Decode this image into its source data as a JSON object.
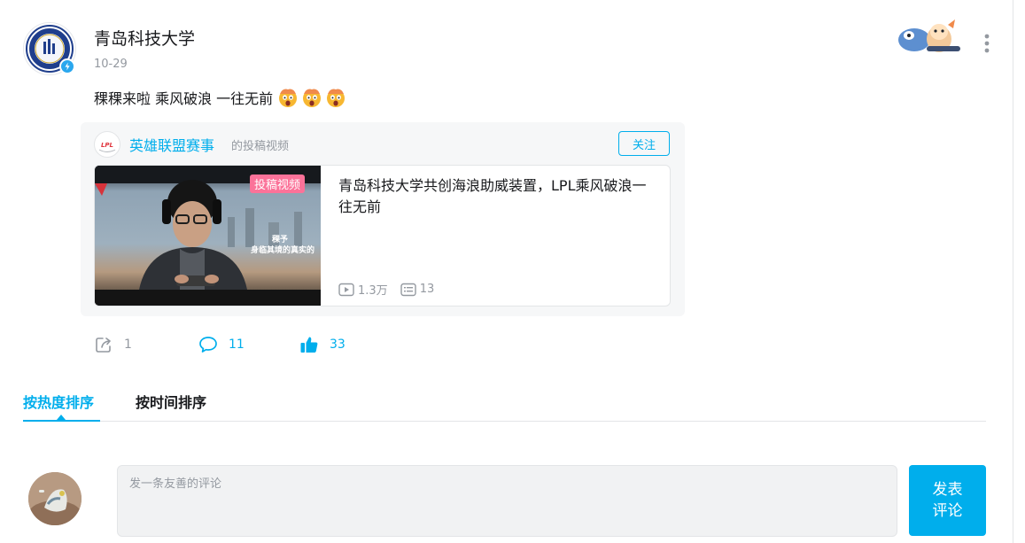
{
  "post": {
    "author": {
      "name": "青岛科技大学",
      "avatar_logo_text": "QUST",
      "verified": true
    },
    "date": "10-29",
    "text": "稞稞来啦 乘风破浪 一往无前",
    "emojis": [
      "shocked-face-emoji",
      "shocked-face-emoji",
      "shocked-face-emoji"
    ]
  },
  "repost": {
    "source": {
      "name": "英雄联盟赛事",
      "action": "的投稿视频",
      "avatar_logo_text": "LPL",
      "follow_label": "关注"
    },
    "video": {
      "badge": "投稿视频",
      "title": "青岛科技大学共创海浪助威装置，LPL乘风破浪一往无前",
      "views": "1.3万",
      "danmaku": "13",
      "caption_line1": "稞予",
      "caption_line2": "身临其境的真实的"
    }
  },
  "actions": {
    "share_count": "1",
    "comment_count": "11",
    "like_count": "33"
  },
  "sort_tabs": [
    {
      "label": "按热度排序",
      "active": true
    },
    {
      "label": "按时间排序",
      "active": false
    }
  ],
  "composer": {
    "placeholder": "发一条友善的评论",
    "submit_line1": "发表",
    "submit_line2": "评论"
  },
  "colors": {
    "accent": "#00aeec",
    "badge_pink": "#fb7299",
    "muted_text": "#9499a0",
    "card_background": "#f6f7f8"
  }
}
